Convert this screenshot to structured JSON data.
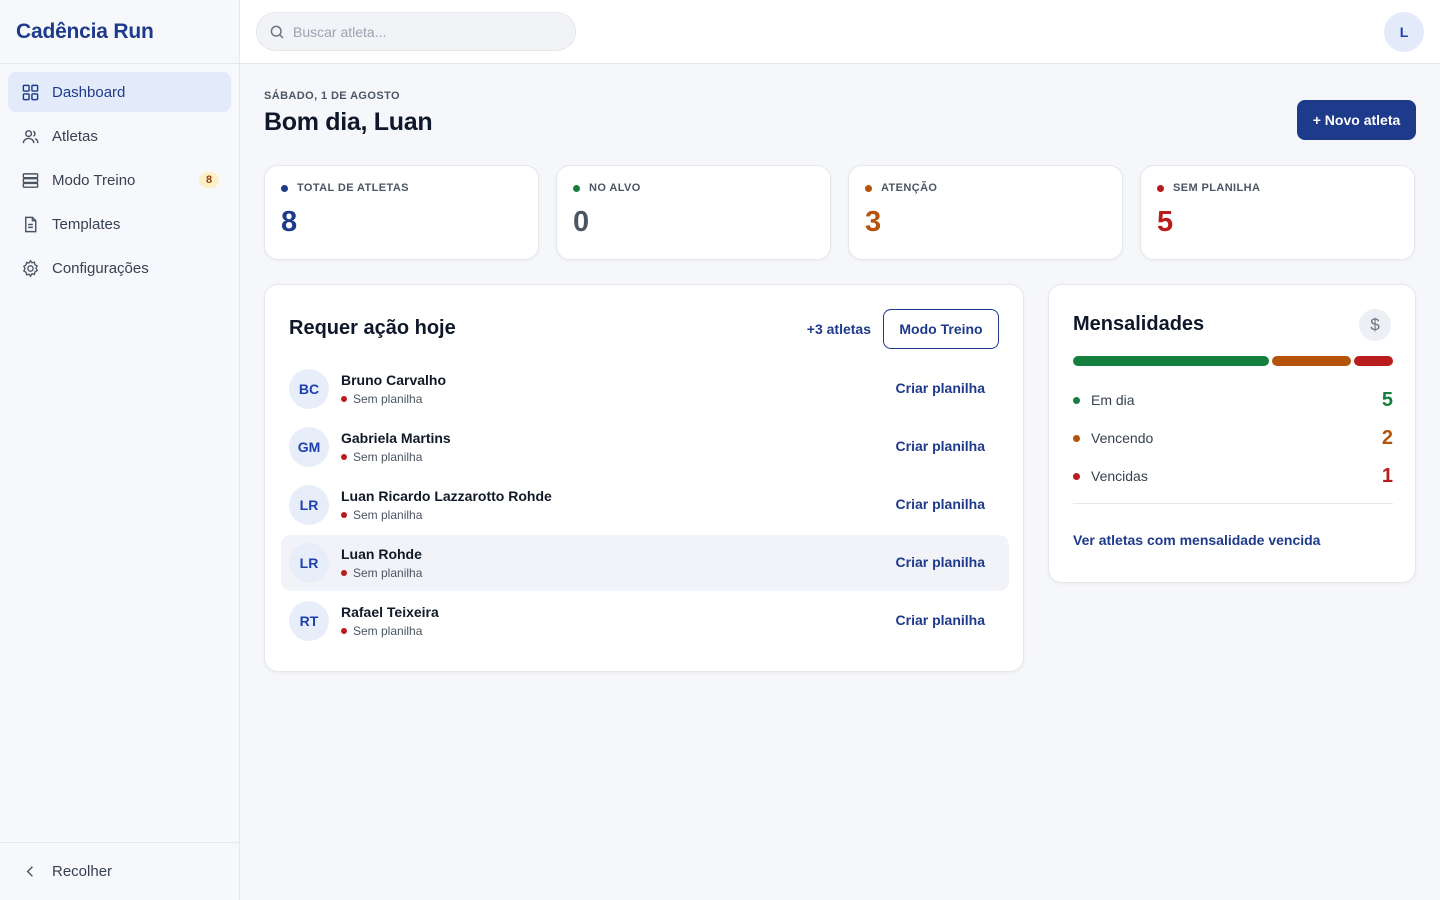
{
  "app": {
    "brand": "Cadência Run"
  },
  "sidebar": {
    "items": [
      {
        "label": "Dashboard",
        "icon": "grid-icon",
        "active": true
      },
      {
        "label": "Atletas",
        "icon": "users-icon"
      },
      {
        "label": "Modo Treino",
        "icon": "list-icon",
        "badge": "8"
      },
      {
        "label": "Templates",
        "icon": "document-icon"
      },
      {
        "label": "Configurações",
        "icon": "gear-icon"
      }
    ],
    "collapse_label": "Recolher"
  },
  "topbar": {
    "search_placeholder": "Buscar atleta...",
    "avatar_initial": "L"
  },
  "header": {
    "date": "SÁBADO, 1 DE AGOSTO",
    "greeting": "Bom dia, Luan",
    "new_button": "+ Novo atleta"
  },
  "stats": [
    {
      "label": "TOTAL DE ATLETAS",
      "value": "8",
      "color": "#1e3a8a"
    },
    {
      "label": "NO ALVO",
      "value": "0",
      "color": "#15803d",
      "value_color": "#4b5563"
    },
    {
      "label": "ATENÇÃO",
      "value": "3",
      "color": "#b45309"
    },
    {
      "label": "SEM PLANILHA",
      "value": "5",
      "color": "#b91c1c"
    }
  ],
  "action_card": {
    "title": "Requer ação hoje",
    "more_link": "+3 atletas",
    "mode_button": "Modo Treino",
    "rows": [
      {
        "initials": "BC",
        "name": "Bruno Carvalho",
        "status": "Sem planilha",
        "action": "Criar planilha"
      },
      {
        "initials": "GM",
        "name": "Gabriela Martins",
        "status": "Sem planilha",
        "action": "Criar planilha"
      },
      {
        "initials": "LR",
        "name": "Luan Ricardo Lazzarotto Rohde",
        "status": "Sem planilha",
        "action": "Criar planilha"
      },
      {
        "initials": "LR",
        "name": "Luan Rohde",
        "status": "Sem planilha",
        "action": "Criar planilha",
        "hover": true
      },
      {
        "initials": "RT",
        "name": "Rafael Teixeira",
        "status": "Sem planilha",
        "action": "Criar planilha"
      }
    ]
  },
  "fees": {
    "title": "Mensalidades",
    "icon": "dollar-icon",
    "rows": [
      {
        "label": "Em dia",
        "count": "5",
        "color": "#15803d"
      },
      {
        "label": "Vencendo",
        "count": "2",
        "color": "#b45309"
      },
      {
        "label": "Vencidas",
        "count": "1",
        "color": "#b91c1c"
      }
    ],
    "link": "Ver atletas com mensalidade vencida"
  },
  "colors": {
    "accent": "#1e3a8a",
    "success": "#15803d",
    "warning": "#b45309",
    "danger": "#b91c1c"
  }
}
